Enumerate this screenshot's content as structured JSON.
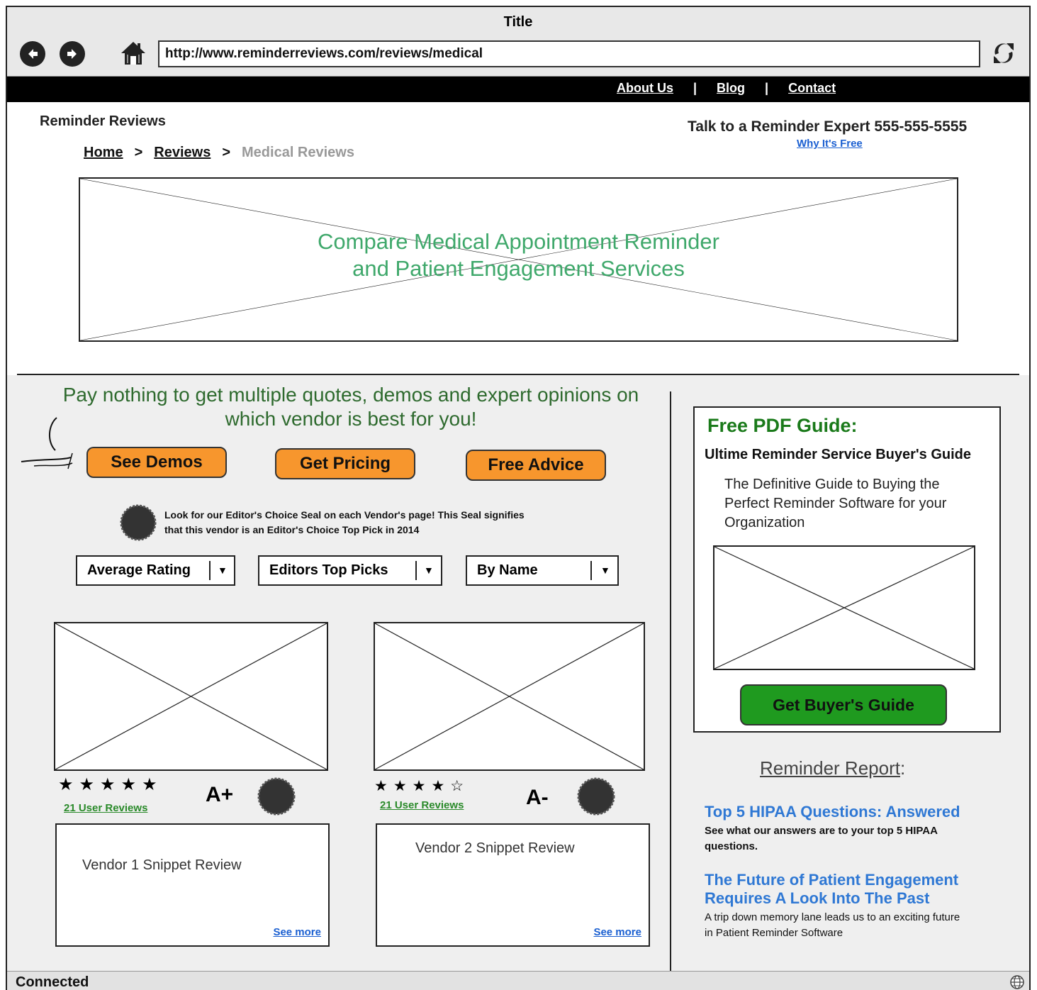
{
  "window": {
    "title": "Title",
    "url": "http://www.reminderreviews.com/reviews/medical"
  },
  "topnav": {
    "about": "About Us",
    "sep": "|",
    "blog": "Blog",
    "contact": "Contact"
  },
  "header": {
    "brand": "Reminder Reviews",
    "expert": "Talk to a Reminder Expert 555-555-5555",
    "why_free": "Why It's Free"
  },
  "breadcrumb": {
    "home": "Home",
    "sep": ">",
    "reviews": "Reviews",
    "current": "Medical Reviews"
  },
  "hero": {
    "line1": "Compare Medical Appointment Reminder",
    "line2": "and Patient Engagement Services"
  },
  "promo": {
    "line1": "Pay nothing to get multiple quotes, demos and expert opinions on",
    "line2": "which vendor is best for you!"
  },
  "cta": {
    "demos": "See Demos",
    "pricing": "Get Pricing",
    "advice": "Free Advice"
  },
  "seal_note": {
    "line1": "Look for our Editor's Choice Seal on each Vendor's page! This Seal signifies",
    "line2": "that this vendor is an Editor's Choice Top Pick in 2014"
  },
  "filters": [
    {
      "label": "Average Rating"
    },
    {
      "label": "Editors Top Picks"
    },
    {
      "label": "By Name"
    }
  ],
  "vendors": [
    {
      "stars": "★★★★★",
      "rating": 5,
      "reviews": "21 User Reviews",
      "grade": "A+",
      "snippet": "Vendor 1 Snippet Review",
      "more": "See more"
    },
    {
      "stars": "★★★★☆",
      "rating": 4,
      "reviews": "21 User Reviews",
      "grade": "A-",
      "snippet": "Vendor 2 Snippet Review",
      "more": "See more"
    }
  ],
  "guide": {
    "title": "Free PDF Guide:",
    "subtitle": "Ultime Reminder Service Buyer's Guide",
    "desc_line1": "The Definitive Guide to Buying the",
    "desc_line2": "Perfect Reminder Software for your",
    "desc_line3": "Organization",
    "button": "Get Buyer's Guide"
  },
  "report": {
    "title_underlined": "Reminder Report",
    "title_suffix": ":",
    "articles": [
      {
        "title_line1": "Top 5 HIPAA Questions: Answered",
        "desc_line1": "See what our answers are to your top 5 HIPAA",
        "desc_line2": "questions."
      },
      {
        "title_line1": "The Future of Patient Engagement",
        "title_line2": "Requires A Look Into The Past",
        "desc_line1": "A trip down memory lane leads us to an exciting future",
        "desc_line2": "in Patient Reminder Software"
      }
    ]
  },
  "status": {
    "text": "Connected"
  },
  "icons": {
    "back": "back-arrow-icon",
    "forward": "forward-arrow-icon",
    "home": "home-icon",
    "refresh": "refresh-icon",
    "seal": "seal-icon",
    "globe": "globe-icon",
    "dropdown": "dropdown-arrow-icon"
  },
  "colors": {
    "promo_green": "#2e6a2e",
    "hero_green": "#3fa86b",
    "cta_orange": "#f7962d",
    "guide_button_green": "#1f9a1f",
    "link_blue": "#2f78d4"
  }
}
